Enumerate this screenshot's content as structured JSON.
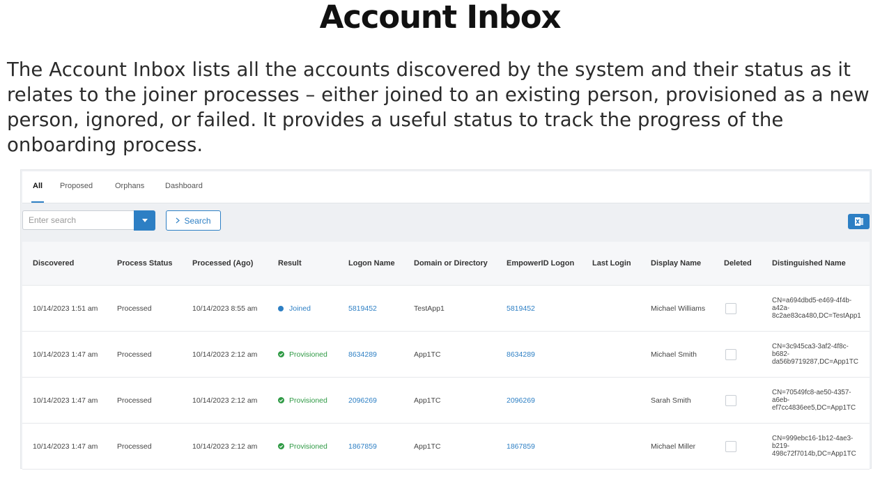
{
  "title": "Account Inbox",
  "intro": "The Account Inbox lists all the accounts discovered by the system and their status as it relates to the joiner processes – either joined to an existing person, provisioned as a new person, ignored, or failed.  It provides a useful status to track the progress of the onboarding process.",
  "tabs": [
    "All",
    "Proposed",
    "Orphans",
    "Dashboard"
  ],
  "search": {
    "placeholder": "Enter search",
    "button_label": "Search"
  },
  "columns": [
    "Discovered",
    "Process Status",
    "Processed (Ago)",
    "Result",
    "Logon Name",
    "Domain or Directory",
    "EmpowerID Logon",
    "Last Login",
    "Display Name",
    "Deleted",
    "Distinguished Name"
  ],
  "rows": [
    {
      "discovered": "10/14/2023 1:51 am",
      "process_status": "Processed",
      "processed": "10/14/2023 8:55 am",
      "result": "Joined",
      "logon": "5819452",
      "domain": "TestApp1",
      "empower": "5819452",
      "last_login": "",
      "display": "Michael Williams",
      "dn": [
        "CN=a694dbd5-e469-4f4b-",
        "a42a-",
        "8c2ae83ca480,DC=TestApp1"
      ]
    },
    {
      "discovered": "10/14/2023 1:47 am",
      "process_status": "Processed",
      "processed": "10/14/2023 2:12 am",
      "result": "Provisioned",
      "logon": "8634289",
      "domain": "App1TC",
      "empower": "8634289",
      "last_login": "",
      "display": "Michael Smith",
      "dn": [
        "CN=3c945ca3-3af2-4f8c-",
        "b682-",
        "da56b9719287,DC=App1TC"
      ]
    },
    {
      "discovered": "10/14/2023 1:47 am",
      "process_status": "Processed",
      "processed": "10/14/2023 2:12 am",
      "result": "Provisioned",
      "logon": "2096269",
      "domain": "App1TC",
      "empower": "2096269",
      "last_login": "",
      "display": "Sarah Smith",
      "dn": [
        "CN=70549fc8-ae50-4357-",
        "a6eb-",
        "ef7cc4836ee5,DC=App1TC"
      ]
    },
    {
      "discovered": "10/14/2023 1:47 am",
      "process_status": "Processed",
      "processed": "10/14/2023 2:12 am",
      "result": "Provisioned",
      "logon": "1867859",
      "domain": "App1TC",
      "empower": "1867859",
      "last_login": "",
      "display": "Michael Miller",
      "dn": [
        "CN=999ebc16-1b12-4ae3-",
        "b219-",
        "498c72f7014b,DC=App1TC"
      ]
    }
  ],
  "colors": {
    "accent": "#2d7fc4",
    "provisioned": "#2f9a45"
  },
  "icons": [
    "chevron-down-icon",
    "chevron-right-icon",
    "excel-export-icon",
    "joined-dot-icon",
    "check-circle-icon"
  ]
}
